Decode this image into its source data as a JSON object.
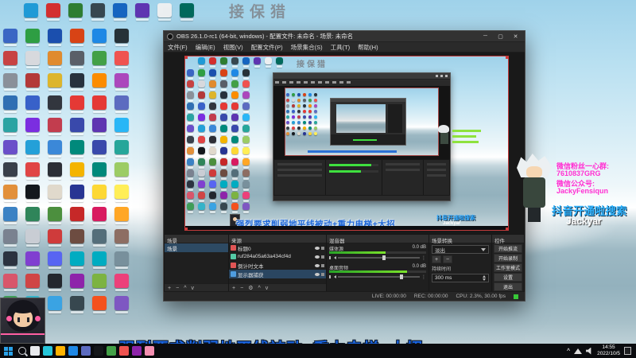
{
  "desktop": {
    "watermark": "接保猎",
    "overlay_text": "强烈要求削弱地平线被动+重力电梯+大招",
    "top_icon_colors": [
      "#1f9ad6",
      "#d32f2f",
      "#2e7d32",
      "#37474f",
      "#1565c0",
      "#5e35b1",
      "#eceff1",
      "#00695c"
    ],
    "icon_columns": [
      [
        "#3a66c4",
        "#c74343",
        "#8a9099",
        "#2f6fb3",
        "#2aa3a3",
        "#6a4fc9",
        "#39404a",
        "#e2903a",
        "#3b82c4",
        "#7a8290",
        "#2b3340",
        "#d8566b",
        "#3f9d58"
      ],
      [
        "#2e9e43",
        "#d7d9dd",
        "#b33939",
        "#3861c9",
        "#7b2ee0",
        "#24a0d8",
        "#e04545",
        "#14181d",
        "#2f855a",
        "#c9cdd4",
        "#803fd0",
        "#d04545",
        "#35b3c9"
      ],
      [
        "#1b4fae",
        "#e08b2e",
        "#ddb52b",
        "#32363e",
        "#c23d4e",
        "#3b88d8",
        "#2c2f36",
        "#e0d9cc",
        "#4c8f3e",
        "#cf3b3b",
        "#5865f2",
        "#23272e",
        "#3aa3e3"
      ],
      [
        "#d84315",
        "#5a5f68",
        "#27313d",
        "#e53935",
        "#3949ab",
        "#00897b",
        "#f4b400",
        "#283593",
        "#c62828",
        "#6d4c41",
        "#00acc1",
        "#8e24aa",
        "#37474f"
      ],
      [
        "#1e88e5",
        "#43a047",
        "#fb8c00",
        "#e53935",
        "#5e35b1",
        "#3949ab",
        "#00897b",
        "#fdd835",
        "#d81b60",
        "#546e7a",
        "#00acc1",
        "#7cb342",
        "#f4511e"
      ],
      [
        "#263238",
        "#ef5350",
        "#ab47bc",
        "#5c6bc0",
        "#29b6f6",
        "#26a69a",
        "#9ccc65",
        "#ffee58",
        "#ffa726",
        "#8d6e63",
        "#78909c",
        "#ec407a",
        "#7e57c2"
      ]
    ]
  },
  "obs": {
    "title": "OBS 26.1.0-rc1 (64-bit, windows) - 配置文件: 未命名 - 场景: 未命名",
    "menus": [
      "文件(F)",
      "编辑(E)",
      "视图(V)",
      "配置文件(P)",
      "场景集合(S)",
      "工具(T)",
      "帮助(H)"
    ],
    "scenes": {
      "title": "场景",
      "items": [
        "场景"
      ]
    },
    "sources": {
      "title": "来源",
      "items": [
        {
          "name": "标题0",
          "type": "text",
          "color": "#e05555"
        },
        {
          "name": "ruf284a05a63a434cf4d",
          "type": "image",
          "color": "#55c9a6"
        },
        {
          "name": "倒计时文本",
          "type": "text",
          "color": "#e05555"
        },
        {
          "name": "显示器捕获",
          "type": "display",
          "color": "#4f9de0"
        }
      ]
    },
    "mixer": {
      "title": "混音器",
      "channels": [
        {
          "name": "媒体源",
          "db": "0.0 dB",
          "level": 58
        },
        {
          "name": "桌面音频",
          "db": "0.0 dB",
          "level": 80
        }
      ]
    },
    "transitions": {
      "title": "场景转换",
      "selected": "淡出",
      "duration_label": "持续时间",
      "duration": "300 ms"
    },
    "controls": {
      "title": "控件",
      "buttons": [
        "开始推流",
        "开始录制",
        "工作室模式",
        "设置",
        "退出"
      ]
    },
    "statusbar": {
      "live": "LIVE: 00:00:00",
      "rec": "REC: 00:00:00",
      "cpu": "CPU: 2.3%, 30.00 fps"
    }
  },
  "overlay_right": {
    "line1": "微信粉丝一心群:",
    "line2": "7610837GRG",
    "line3": "微信公众号:",
    "line4": "JackyFensiqun",
    "douyin": "抖音开通啦搜索",
    "name": "Jackyar"
  },
  "taskbar": {
    "time": "14:55",
    "date": "2022/10/5",
    "icon_colors": [
      "#e8eaed",
      "#26c6da",
      "#ffb300",
      "#1e88e5",
      "#5c6bc0",
      "#15171a",
      "#43a047",
      "#ef5350",
      "#8e24aa",
      "#f48fb1"
    ]
  },
  "glyphs": {
    "plus": "+",
    "minus": "−",
    "up": "^",
    "down": "v",
    "gear": "⚙",
    "dots": "⋮",
    "min": "─",
    "max": "▢",
    "close": "✕"
  }
}
